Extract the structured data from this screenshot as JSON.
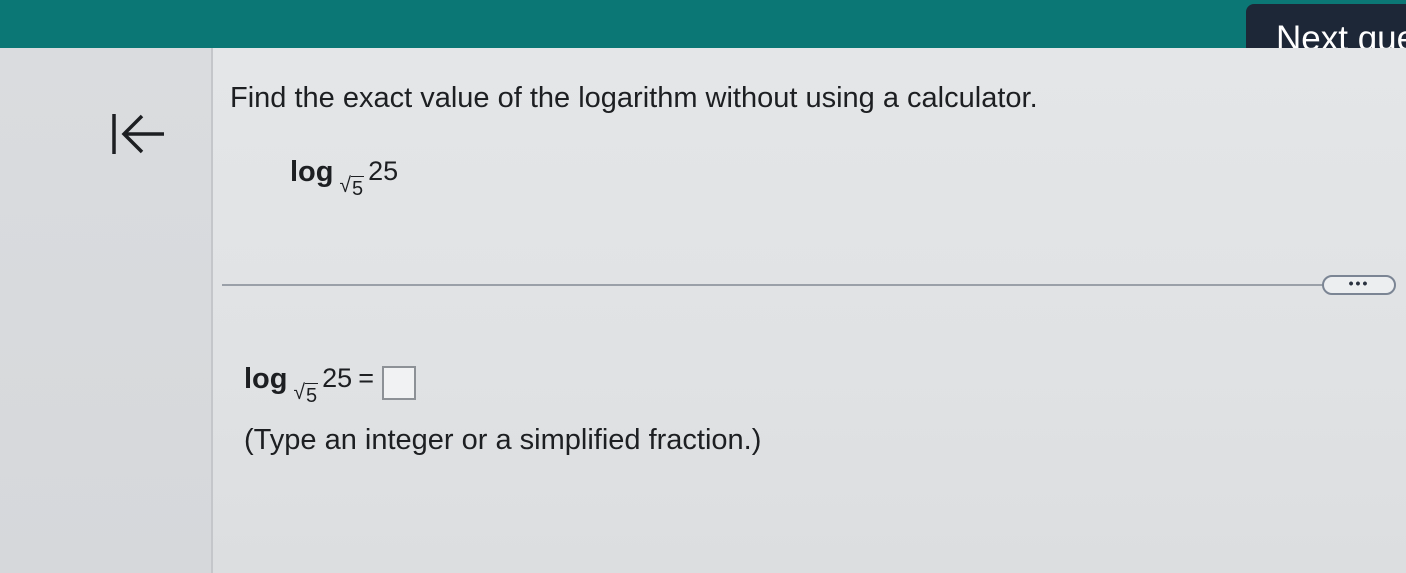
{
  "header": {
    "next_button_label": "Next que"
  },
  "nav": {
    "collapse_icon": "arrow-left-to-bar-icon"
  },
  "question": {
    "instruction": "Find the exact value of the logarithm without using a calculator.",
    "log_word": "log",
    "base_radicand": "5",
    "argument": "25"
  },
  "more_button": {
    "icon": "ellipsis-icon",
    "label": "..."
  },
  "answer": {
    "log_word": "log",
    "base_radicand": "5",
    "argument": "25",
    "equals": "=",
    "value": "",
    "hint": "(Type an integer or a simplified fraction.)"
  },
  "colors": {
    "top_bar": "#0b7775",
    "next_button_bg": "#1d2737"
  }
}
